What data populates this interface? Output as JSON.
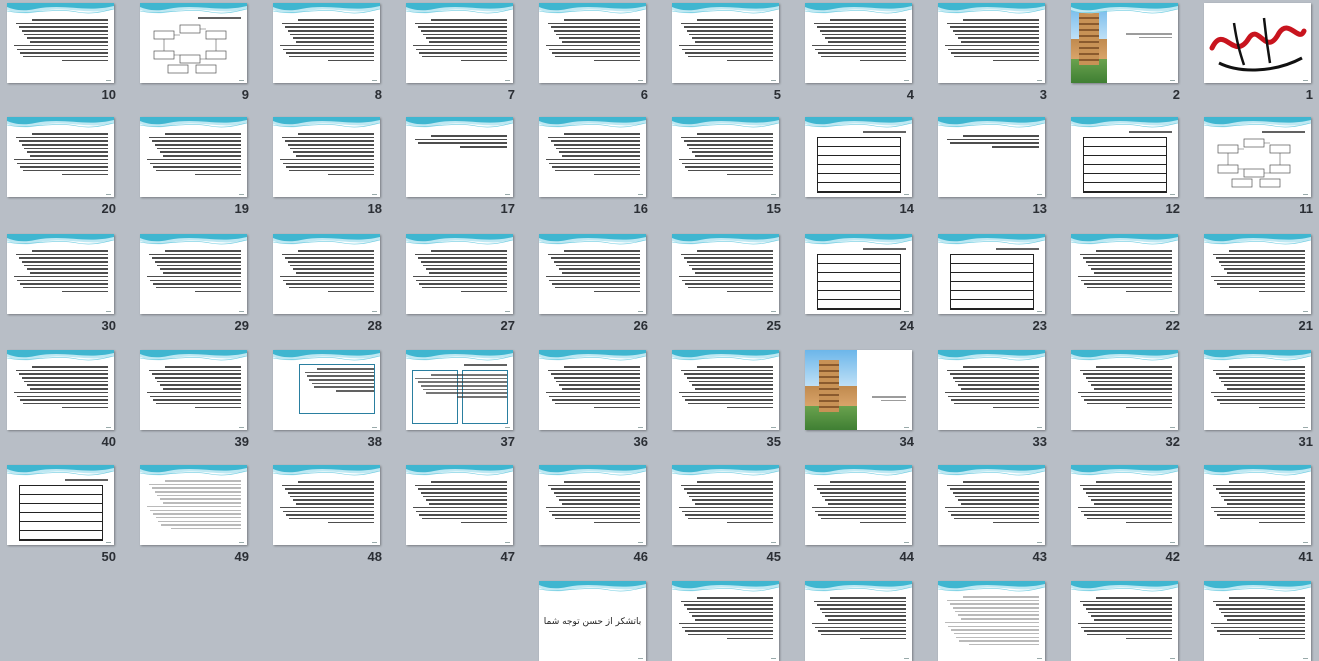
{
  "window": {
    "view": "slide-sorter"
  },
  "colors": {
    "background": "#b8bec6",
    "accent": "#3fb6d0",
    "text": "#2b2f35"
  },
  "slides": [
    {
      "n": "1",
      "kind": "calligraphy"
    },
    {
      "n": "2",
      "kind": "title-photo"
    },
    {
      "n": "3",
      "kind": "text"
    },
    {
      "n": "4",
      "kind": "text"
    },
    {
      "n": "5",
      "kind": "text"
    },
    {
      "n": "6",
      "kind": "text"
    },
    {
      "n": "7",
      "kind": "text"
    },
    {
      "n": "8",
      "kind": "text"
    },
    {
      "n": "9",
      "kind": "diagram"
    },
    {
      "n": "10",
      "kind": "text"
    },
    {
      "n": "11",
      "kind": "diagram"
    },
    {
      "n": "12",
      "kind": "table"
    },
    {
      "n": "13",
      "kind": "text-short"
    },
    {
      "n": "14",
      "kind": "table"
    },
    {
      "n": "15",
      "kind": "text"
    },
    {
      "n": "16",
      "kind": "text"
    },
    {
      "n": "17",
      "kind": "text-short"
    },
    {
      "n": "18",
      "kind": "text"
    },
    {
      "n": "19",
      "kind": "text"
    },
    {
      "n": "20",
      "kind": "text"
    },
    {
      "n": "21",
      "kind": "text"
    },
    {
      "n": "22",
      "kind": "text"
    },
    {
      "n": "23",
      "kind": "table"
    },
    {
      "n": "24",
      "kind": "table"
    },
    {
      "n": "25",
      "kind": "text"
    },
    {
      "n": "26",
      "kind": "text"
    },
    {
      "n": "27",
      "kind": "text"
    },
    {
      "n": "28",
      "kind": "text"
    },
    {
      "n": "29",
      "kind": "text"
    },
    {
      "n": "30",
      "kind": "text"
    },
    {
      "n": "31",
      "kind": "text"
    },
    {
      "n": "32",
      "kind": "text"
    },
    {
      "n": "33",
      "kind": "text"
    },
    {
      "n": "34",
      "kind": "photo"
    },
    {
      "n": "35",
      "kind": "text"
    },
    {
      "n": "36",
      "kind": "text"
    },
    {
      "n": "37",
      "kind": "boxes"
    },
    {
      "n": "38",
      "kind": "box"
    },
    {
      "n": "39",
      "kind": "text"
    },
    {
      "n": "40",
      "kind": "text"
    },
    {
      "n": "41",
      "kind": "text"
    },
    {
      "n": "42",
      "kind": "text"
    },
    {
      "n": "43",
      "kind": "text"
    },
    {
      "n": "44",
      "kind": "text"
    },
    {
      "n": "45",
      "kind": "text"
    },
    {
      "n": "46",
      "kind": "text"
    },
    {
      "n": "47",
      "kind": "text"
    },
    {
      "n": "48",
      "kind": "text"
    },
    {
      "n": "49",
      "kind": "text-light"
    },
    {
      "n": "50",
      "kind": "table"
    },
    {
      "n": "",
      "kind": "text"
    },
    {
      "n": "",
      "kind": "text"
    },
    {
      "n": "",
      "kind": "text-light"
    },
    {
      "n": "",
      "kind": "text"
    },
    {
      "n": "",
      "kind": "text"
    },
    {
      "n": "",
      "kind": "thanks",
      "text": "باتشکر از حسن توجه شما"
    }
  ]
}
